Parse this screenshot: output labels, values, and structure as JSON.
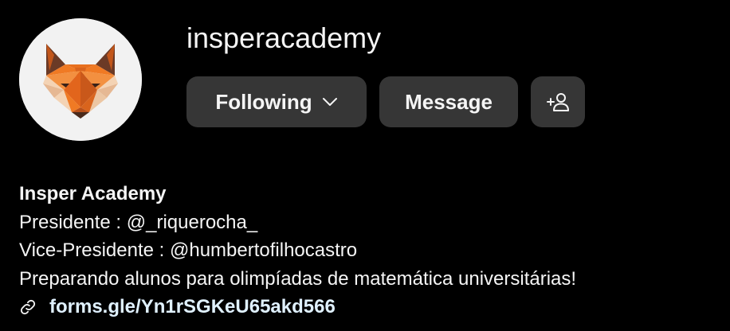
{
  "profile": {
    "username": "insperacademy",
    "avatar_icon": "fox-logo-icon",
    "brand_colors": {
      "fox_orange": "#f07a24",
      "fox_dark": "#c2561a",
      "fox_cream": "#f4d3b4",
      "fox_brown": "#6b3a26",
      "avatar_bg": "#f2f2f2"
    }
  },
  "actions": {
    "following_label": "Following",
    "following_icon": "chevron-down-icon",
    "message_label": "Message",
    "suggest_icon": "add-person-icon",
    "button_bg": "#363636"
  },
  "bio": {
    "display_name": "Insper Academy",
    "line1": "Presidente : @_riquerocha_",
    "line2": "Vice-Presidente : @humbertofilhocastro",
    "line3": "Preparando alunos para olimpíadas de matemática universitárias!",
    "link_icon": "link-icon",
    "link": "forms.gle/Yn1rSGKeU65akd566",
    "link_color": "#e0f1ff"
  }
}
